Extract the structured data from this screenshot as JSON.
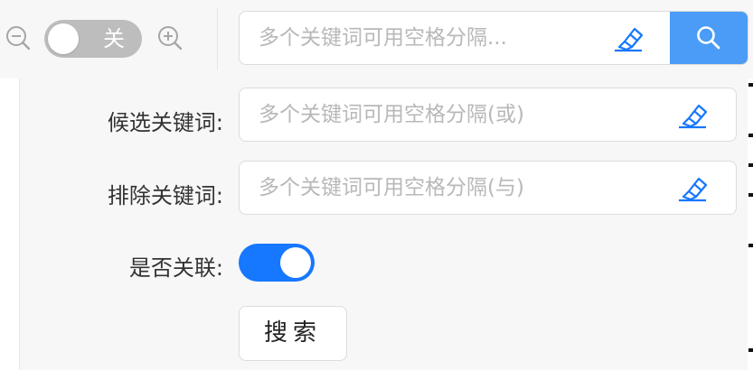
{
  "toolbar": {
    "zoom_out_icon": "zoom-out-icon",
    "zoom_in_icon": "zoom-in-icon",
    "toggle_label": "关",
    "toggle_state": "off",
    "search_placeholder": "多个关键词可用空格分隔...",
    "clear_icon": "eraser-icon",
    "search_icon": "search-icon"
  },
  "panel": {
    "candidate_label": "候选关键词:",
    "candidate_placeholder": "多个关键词可用空格分隔(或)",
    "exclude_label": "排除关键词:",
    "exclude_placeholder": "多个关键词可用空格分隔(与)",
    "related_label": "是否关联:",
    "related_state": "on",
    "submit_label": "搜索"
  },
  "colors": {
    "accent": "#1677ff",
    "search_button": "#4a9cf6",
    "toggle_off": "#bdbdbd",
    "panel_bg": "#f7f7f7",
    "eraser_icon": "#1677ff"
  }
}
